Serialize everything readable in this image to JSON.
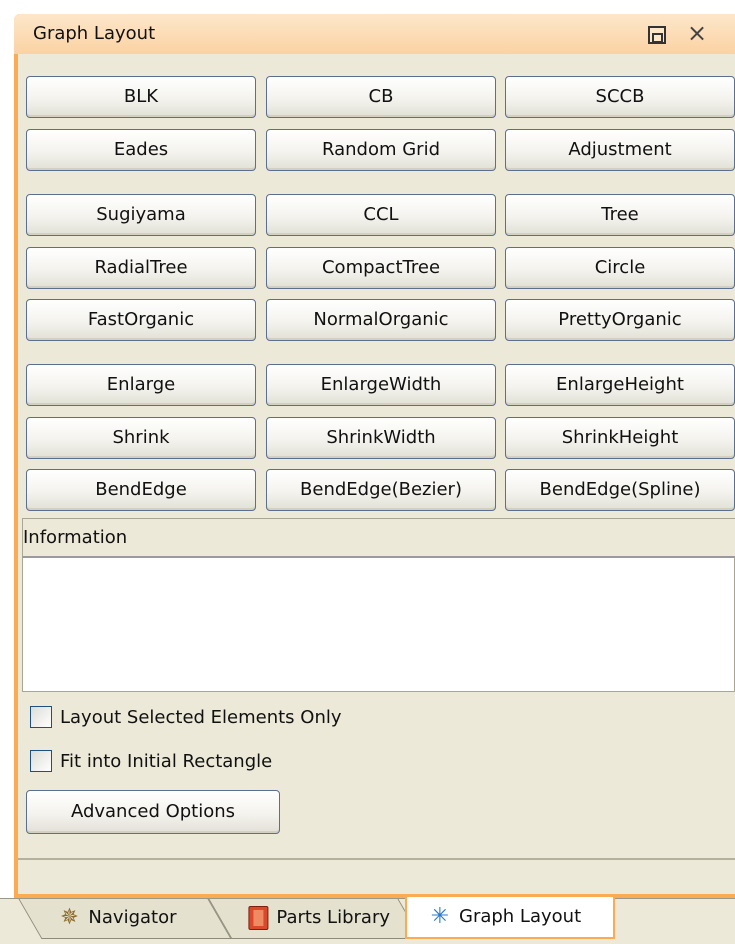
{
  "panel": {
    "title": "Graph Layout",
    "restore_icon": "restore-window-icon",
    "close_glyph": "×"
  },
  "layout_buttons": [
    [
      "BLK",
      "CB",
      "SCCB"
    ],
    [
      "Eades",
      "Random Grid",
      "Adjustment"
    ],
    [
      "Sugiyama",
      "CCL",
      "Tree"
    ],
    [
      "RadialTree",
      "CompactTree",
      "Circle"
    ],
    [
      "FastOrganic",
      "NormalOrganic",
      "PrettyOrganic"
    ],
    [
      "Enlarge",
      "EnlargeWidth",
      "EnlargeHeight"
    ],
    [
      "Shrink",
      "ShrinkWidth",
      "ShrinkHeight"
    ],
    [
      "BendEdge",
      "BendEdge(Bezier)",
      "BendEdge(Spline)"
    ]
  ],
  "information": {
    "label": "Information",
    "text": ""
  },
  "options": {
    "selected_only_label": "Layout Selected Elements Only",
    "selected_only_checked": false,
    "fit_rect_label": "Fit into Initial Rectangle",
    "fit_rect_checked": false,
    "advanced_label": "Advanced Options"
  },
  "tabs": [
    {
      "label": "Navigator",
      "icon": "navigator-icon",
      "active": false
    },
    {
      "label": "Parts Library",
      "icon": "parts-library-icon",
      "active": false
    },
    {
      "label": "Graph Layout",
      "icon": "graph-layout-icon",
      "active": true
    }
  ],
  "colors": {
    "accent_border": "#fbab51",
    "panel_bg": "#ece9d8",
    "button_border": "#5b6f8e"
  }
}
